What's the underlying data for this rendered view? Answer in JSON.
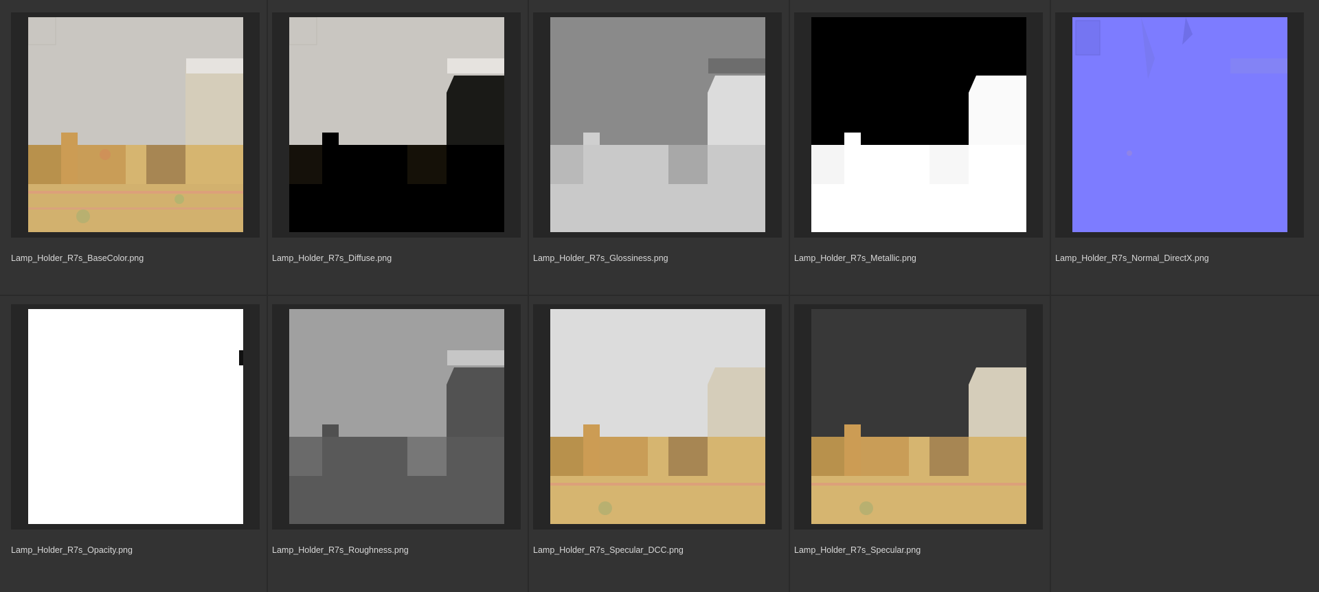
{
  "files": [
    {
      "name": "Lamp_Holder_R7s_BaseColor.png",
      "preview": "basecolor"
    },
    {
      "name": "Lamp_Holder_R7s_Diffuse.png",
      "preview": "diffuse"
    },
    {
      "name": "Lamp_Holder_R7s_Glossiness.png",
      "preview": "glossiness"
    },
    {
      "name": "Lamp_Holder_R7s_Metallic.png",
      "preview": "metallic"
    },
    {
      "name": "Lamp_Holder_R7s_Normal_DirectX.png",
      "preview": "normal"
    },
    {
      "name": "Lamp_Holder_R7s_Opacity.png",
      "preview": "opacity"
    },
    {
      "name": "Lamp_Holder_R7s_Roughness.png",
      "preview": "roughness"
    },
    {
      "name": "Lamp_Holder_R7s_Specular_DCC.png",
      "preview": "specular_dcc"
    },
    {
      "name": "Lamp_Holder_R7s_Specular.png",
      "preview": "specular"
    }
  ],
  "colors": {
    "background": "#333333",
    "frame": "#262626",
    "divider": "#2a2a2a",
    "caption": "#d8d8d8"
  }
}
